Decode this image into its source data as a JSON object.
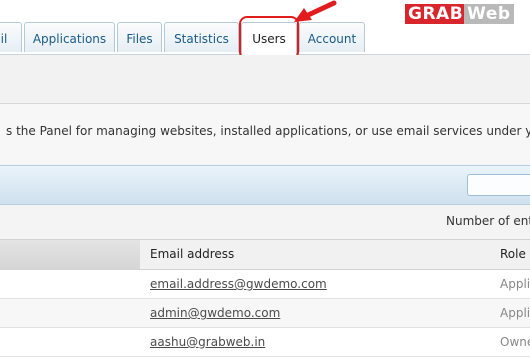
{
  "tabs": [
    {
      "label": "il"
    },
    {
      "label": "Applications"
    },
    {
      "label": "Files"
    },
    {
      "label": "Statistics"
    },
    {
      "label": "Users",
      "active": true
    },
    {
      "label": "Account"
    }
  ],
  "logo": {
    "part1": "GRAB",
    "part2": "Web"
  },
  "description": "s the Panel for managing websites, installed applications, or use email services under your",
  "search": {
    "value": ""
  },
  "entries_label": "Number of ent",
  "table": {
    "headers": {
      "email": "Email address",
      "role": "Role"
    },
    "rows": [
      {
        "email": "email.address@gwdemo.com",
        "role": "Appli"
      },
      {
        "email": "admin@gwdemo.com",
        "role": "Appli"
      },
      {
        "email": "aashu@grabweb.in",
        "role": "Owne"
      }
    ]
  },
  "colors": {
    "tab_text": "#1b5a86",
    "highlight": "#e21c1c",
    "logo_red": "#d9262c",
    "logo_gray": "#b9b9b9"
  },
  "icons": {
    "arrow": "red-arrow-icon"
  }
}
